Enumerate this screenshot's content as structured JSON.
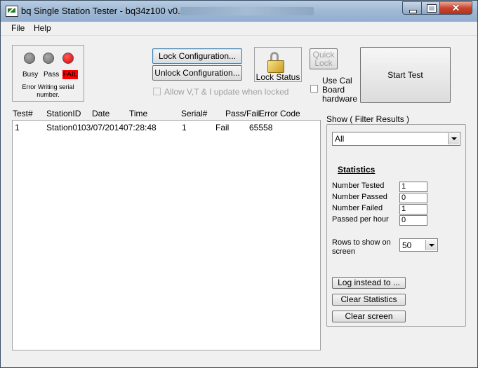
{
  "window": {
    "title": "bq Single Station Tester - bq34z100 v0.06"
  },
  "menu": [
    "File",
    "Help"
  ],
  "status_panel": {
    "indicators": [
      {
        "label": "Busy",
        "color": "#808080"
      },
      {
        "label": "Pass",
        "color": "#808080"
      },
      {
        "label": "FAIL",
        "color": "#ff0000"
      }
    ],
    "message": "Error Writing serial number."
  },
  "buttons": {
    "lock_config": "Lock Configuration...",
    "unlock_config": "Unlock Configuration...",
    "lock_status": "Lock Status",
    "quick_lock_line1": "Quick",
    "quick_lock_line2": "Lock",
    "start_test": "Start Test",
    "log_instead": "Log instead to ...",
    "clear_statistics": "Clear Statistics",
    "clear_screen": "Clear screen"
  },
  "options": {
    "allow_update": "Allow V,T & I update when locked",
    "use_cal_line1": "Use Cal",
    "use_cal_line2": "Board",
    "use_cal_line3": "hardware"
  },
  "results_table": {
    "columns": [
      "Test#",
      "StationID",
      "Date",
      "Time",
      "Serial#",
      "Pass/Fail",
      "Error Code"
    ],
    "rows": [
      {
        "test": "1",
        "station": "Station01",
        "date": "03/07/2014",
        "time": "07:28:48",
        "serial": "1",
        "result": "Fail",
        "error": "65558"
      }
    ]
  },
  "filter": {
    "title": "Show ( Filter Results )",
    "selected": "All"
  },
  "statistics": {
    "heading": "Statistics",
    "number_tested_label": "Number Tested",
    "number_tested": "1",
    "number_passed_label": "Number Passed",
    "number_passed": "0",
    "number_failed_label": "Number Failed",
    "number_failed": "1",
    "passed_per_hour_label": "Passed per hour",
    "passed_per_hour": "0"
  },
  "rows_to_show": {
    "label_line1": "Rows to show on",
    "label_line2": "screen",
    "value": "50"
  }
}
